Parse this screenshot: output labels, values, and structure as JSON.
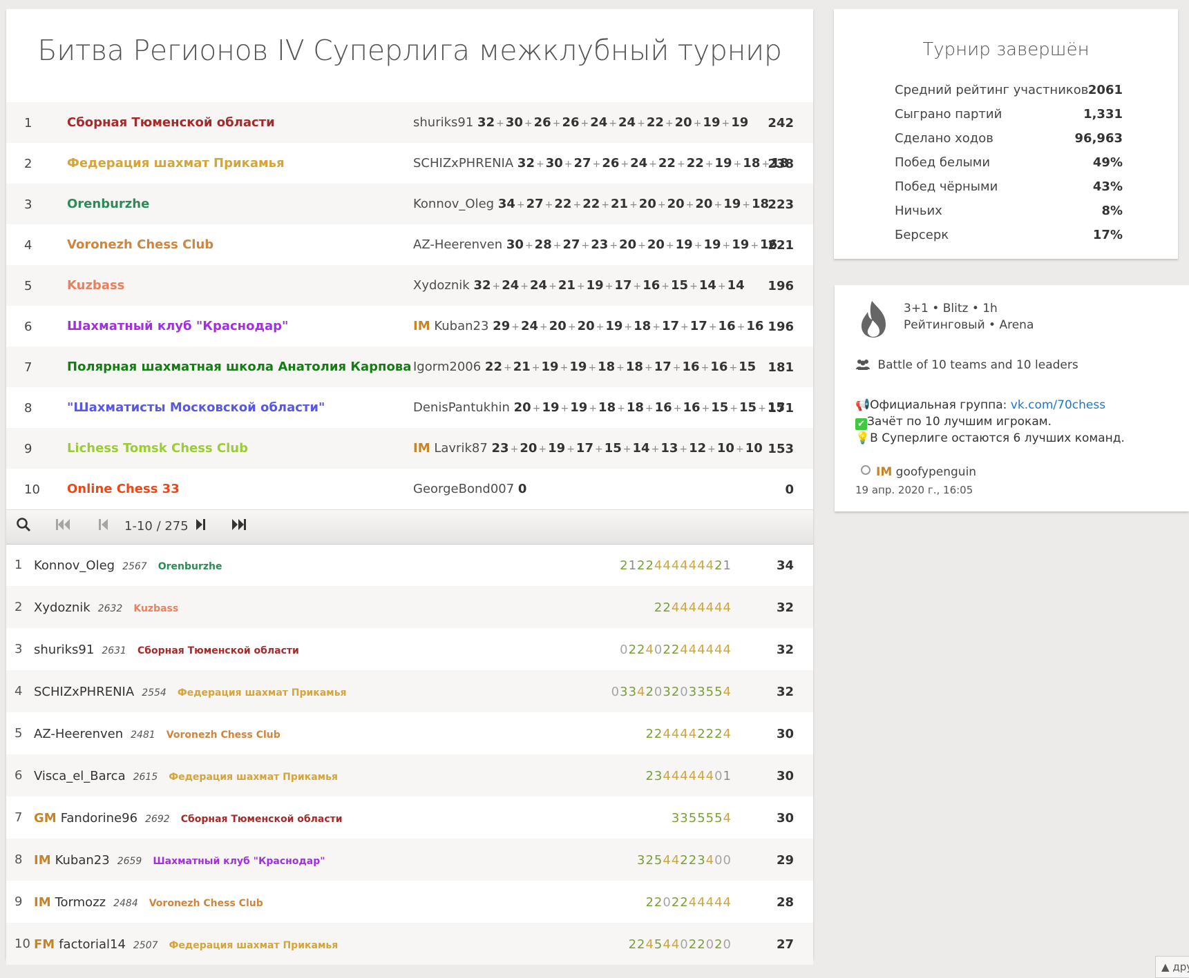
{
  "title": "Битва Регионов IV Суперлига межклубный турнир",
  "teams": [
    {
      "rank": "1",
      "name": "Сборная Тюменской области",
      "color": "#a52a2a",
      "title": "",
      "player": "shuriks91",
      "scores": [
        32,
        30,
        26,
        26,
        24,
        24,
        22,
        20,
        19,
        19
      ],
      "total": "242"
    },
    {
      "rank": "2",
      "name": "Федерация шахмат Прикамья",
      "color": "#d5a43a",
      "title": "",
      "player": "SCHIZxPHRENIA",
      "scores": [
        32,
        30,
        27,
        26,
        24,
        22,
        22,
        19,
        18,
        18
      ],
      "total": "238"
    },
    {
      "rank": "3",
      "name": "Orenburzhe",
      "color": "#2e8b57",
      "title": "",
      "player": "Konnov_Oleg",
      "scores": [
        34,
        27,
        22,
        22,
        21,
        20,
        20,
        20,
        19,
        18
      ],
      "total": "223"
    },
    {
      "rank": "4",
      "name": "Voronezh Chess Club",
      "color": "#cd853f",
      "title": "",
      "player": "AZ-Heerenven",
      "scores": [
        30,
        28,
        27,
        23,
        20,
        20,
        19,
        19,
        19,
        16
      ],
      "total": "221"
    },
    {
      "rank": "5",
      "name": "Kuzbass",
      "color": "#e9805e",
      "title": "",
      "player": "Xydoznik",
      "scores": [
        32,
        24,
        24,
        21,
        19,
        17,
        16,
        15,
        14,
        14
      ],
      "total": "196"
    },
    {
      "rank": "6",
      "name": "Шахматный клуб \"Краснодар\"",
      "color": "#a330e0",
      "title": "IM",
      "player": "Kuban23",
      "scores": [
        29,
        24,
        20,
        20,
        19,
        18,
        17,
        17,
        16,
        16
      ],
      "total": "196"
    },
    {
      "rank": "7",
      "name": "Полярная шахматная школа Анатолия Карпова",
      "color": "#147d14",
      "title": "",
      "player": "Igorm2006",
      "scores": [
        22,
        21,
        19,
        19,
        18,
        18,
        17,
        16,
        16,
        15
      ],
      "total": "181"
    },
    {
      "rank": "8",
      "name": "\"Шахматисты Московской области\"",
      "color": "#5858e0",
      "title": "",
      "player": "DenisPantukhin",
      "scores": [
        20,
        19,
        19,
        18,
        18,
        16,
        16,
        15,
        15,
        15
      ],
      "total": "171"
    },
    {
      "rank": "9",
      "name": "Lichess Tomsk Chess Club",
      "color": "#9acd32",
      "title": "IM",
      "player": "Lavrik87",
      "scores": [
        23,
        20,
        19,
        17,
        15,
        14,
        13,
        12,
        10,
        10
      ],
      "total": "153"
    },
    {
      "rank": "10",
      "name": "Online Chess 33",
      "color": "#e8481a",
      "title": "",
      "player": "GeorgeBond007",
      "scores": [
        0
      ],
      "total": "0"
    }
  ],
  "pager": {
    "range": "1-10 / 275"
  },
  "players": [
    {
      "rank": "1",
      "title": "",
      "name": "Konnov_Oleg",
      "rating": "2567",
      "team": "Orenburzhe",
      "team_color": "#2e8b57",
      "sheet": "2122444444421",
      "score": "34"
    },
    {
      "rank": "2",
      "title": "",
      "name": "Xydoznik",
      "rating": "2632",
      "team": "Kuzbass",
      "team_color": "#e9805e",
      "sheet": "224444444",
      "score": "32"
    },
    {
      "rank": "3",
      "title": "",
      "name": "shuriks91",
      "rating": "2631",
      "team": "Сборная Тюменской области",
      "team_color": "#a52a2a",
      "sheet": "0224022444444",
      "score": "32"
    },
    {
      "rank": "4",
      "title": "",
      "name": "SCHIZxPHRENIA",
      "rating": "2554",
      "team": "Федерация шахмат Прикамья",
      "team_color": "#d5a43a",
      "sheet": "03342032033554",
      "score": "32"
    },
    {
      "rank": "5",
      "title": "",
      "name": "AZ-Heerenven",
      "rating": "2481",
      "team": "Voronezh Chess Club",
      "team_color": "#cd853f",
      "sheet": "2244442224",
      "score": "30"
    },
    {
      "rank": "6",
      "title": "",
      "name": "Visca_el_Barca",
      "rating": "2615",
      "team": "Федерация шахмат Прикамья",
      "team_color": "#d5a43a",
      "sheet": "2344444401",
      "score": "30"
    },
    {
      "rank": "7",
      "title": "GM",
      "name": "Fandorine96",
      "rating": "2692",
      "team": "Сборная Тюменской области",
      "team_color": "#a52a2a",
      "sheet": "3355554",
      "score": "30"
    },
    {
      "rank": "8",
      "title": "IM",
      "name": "Kuban23",
      "rating": "2659",
      "team": "Шахматный клуб \"Краснодар\"",
      "team_color": "#a330e0",
      "sheet": "32544223400",
      "score": "29"
    },
    {
      "rank": "9",
      "title": "IM",
      "name": "Tormozz",
      "rating": "2484",
      "team": "Voronezh Chess Club",
      "team_color": "#cd853f",
      "sheet": "2202244444",
      "score": "28"
    },
    {
      "rank": "10",
      "title": "FM",
      "name": "factorial14",
      "rating": "2507",
      "team": "Федерация шахмат Прикамья",
      "team_color": "#d5a43a",
      "sheet": "224544022020",
      "score": "27"
    }
  ],
  "stats": {
    "title": "Турнир завершён",
    "items": [
      {
        "label": "Средний рейтинг участников",
        "value": "2061"
      },
      {
        "label": "Сыграно партий",
        "value": "1,331"
      },
      {
        "label": "Сделано ходов",
        "value": "96,963"
      },
      {
        "label": "Побед белыми",
        "value": "49%"
      },
      {
        "label": "Побед чёрными",
        "value": "43%"
      },
      {
        "label": "Ничьих",
        "value": "8%"
      },
      {
        "label": "Берсерк",
        "value": "17%"
      }
    ]
  },
  "info": {
    "icon": "flame-icon",
    "line1": "3+1 • Blitz • 1h",
    "line2": "Рейтинговый • Arena",
    "teams_line": "Battle of 10 teams and 10 leaders",
    "group_label": "Официальная группа: ",
    "group_link": "vk.com/70chess",
    "count_line": "Зачёт по 10 лучшим игрокам.",
    "stay_line": "В Суперлиге остаются 6 лучших команд.",
    "creator_title": "IM",
    "creator_name": "goofypenguin",
    "date": "19 апр. 2020 г., 16:05"
  },
  "corner_label": "дру"
}
